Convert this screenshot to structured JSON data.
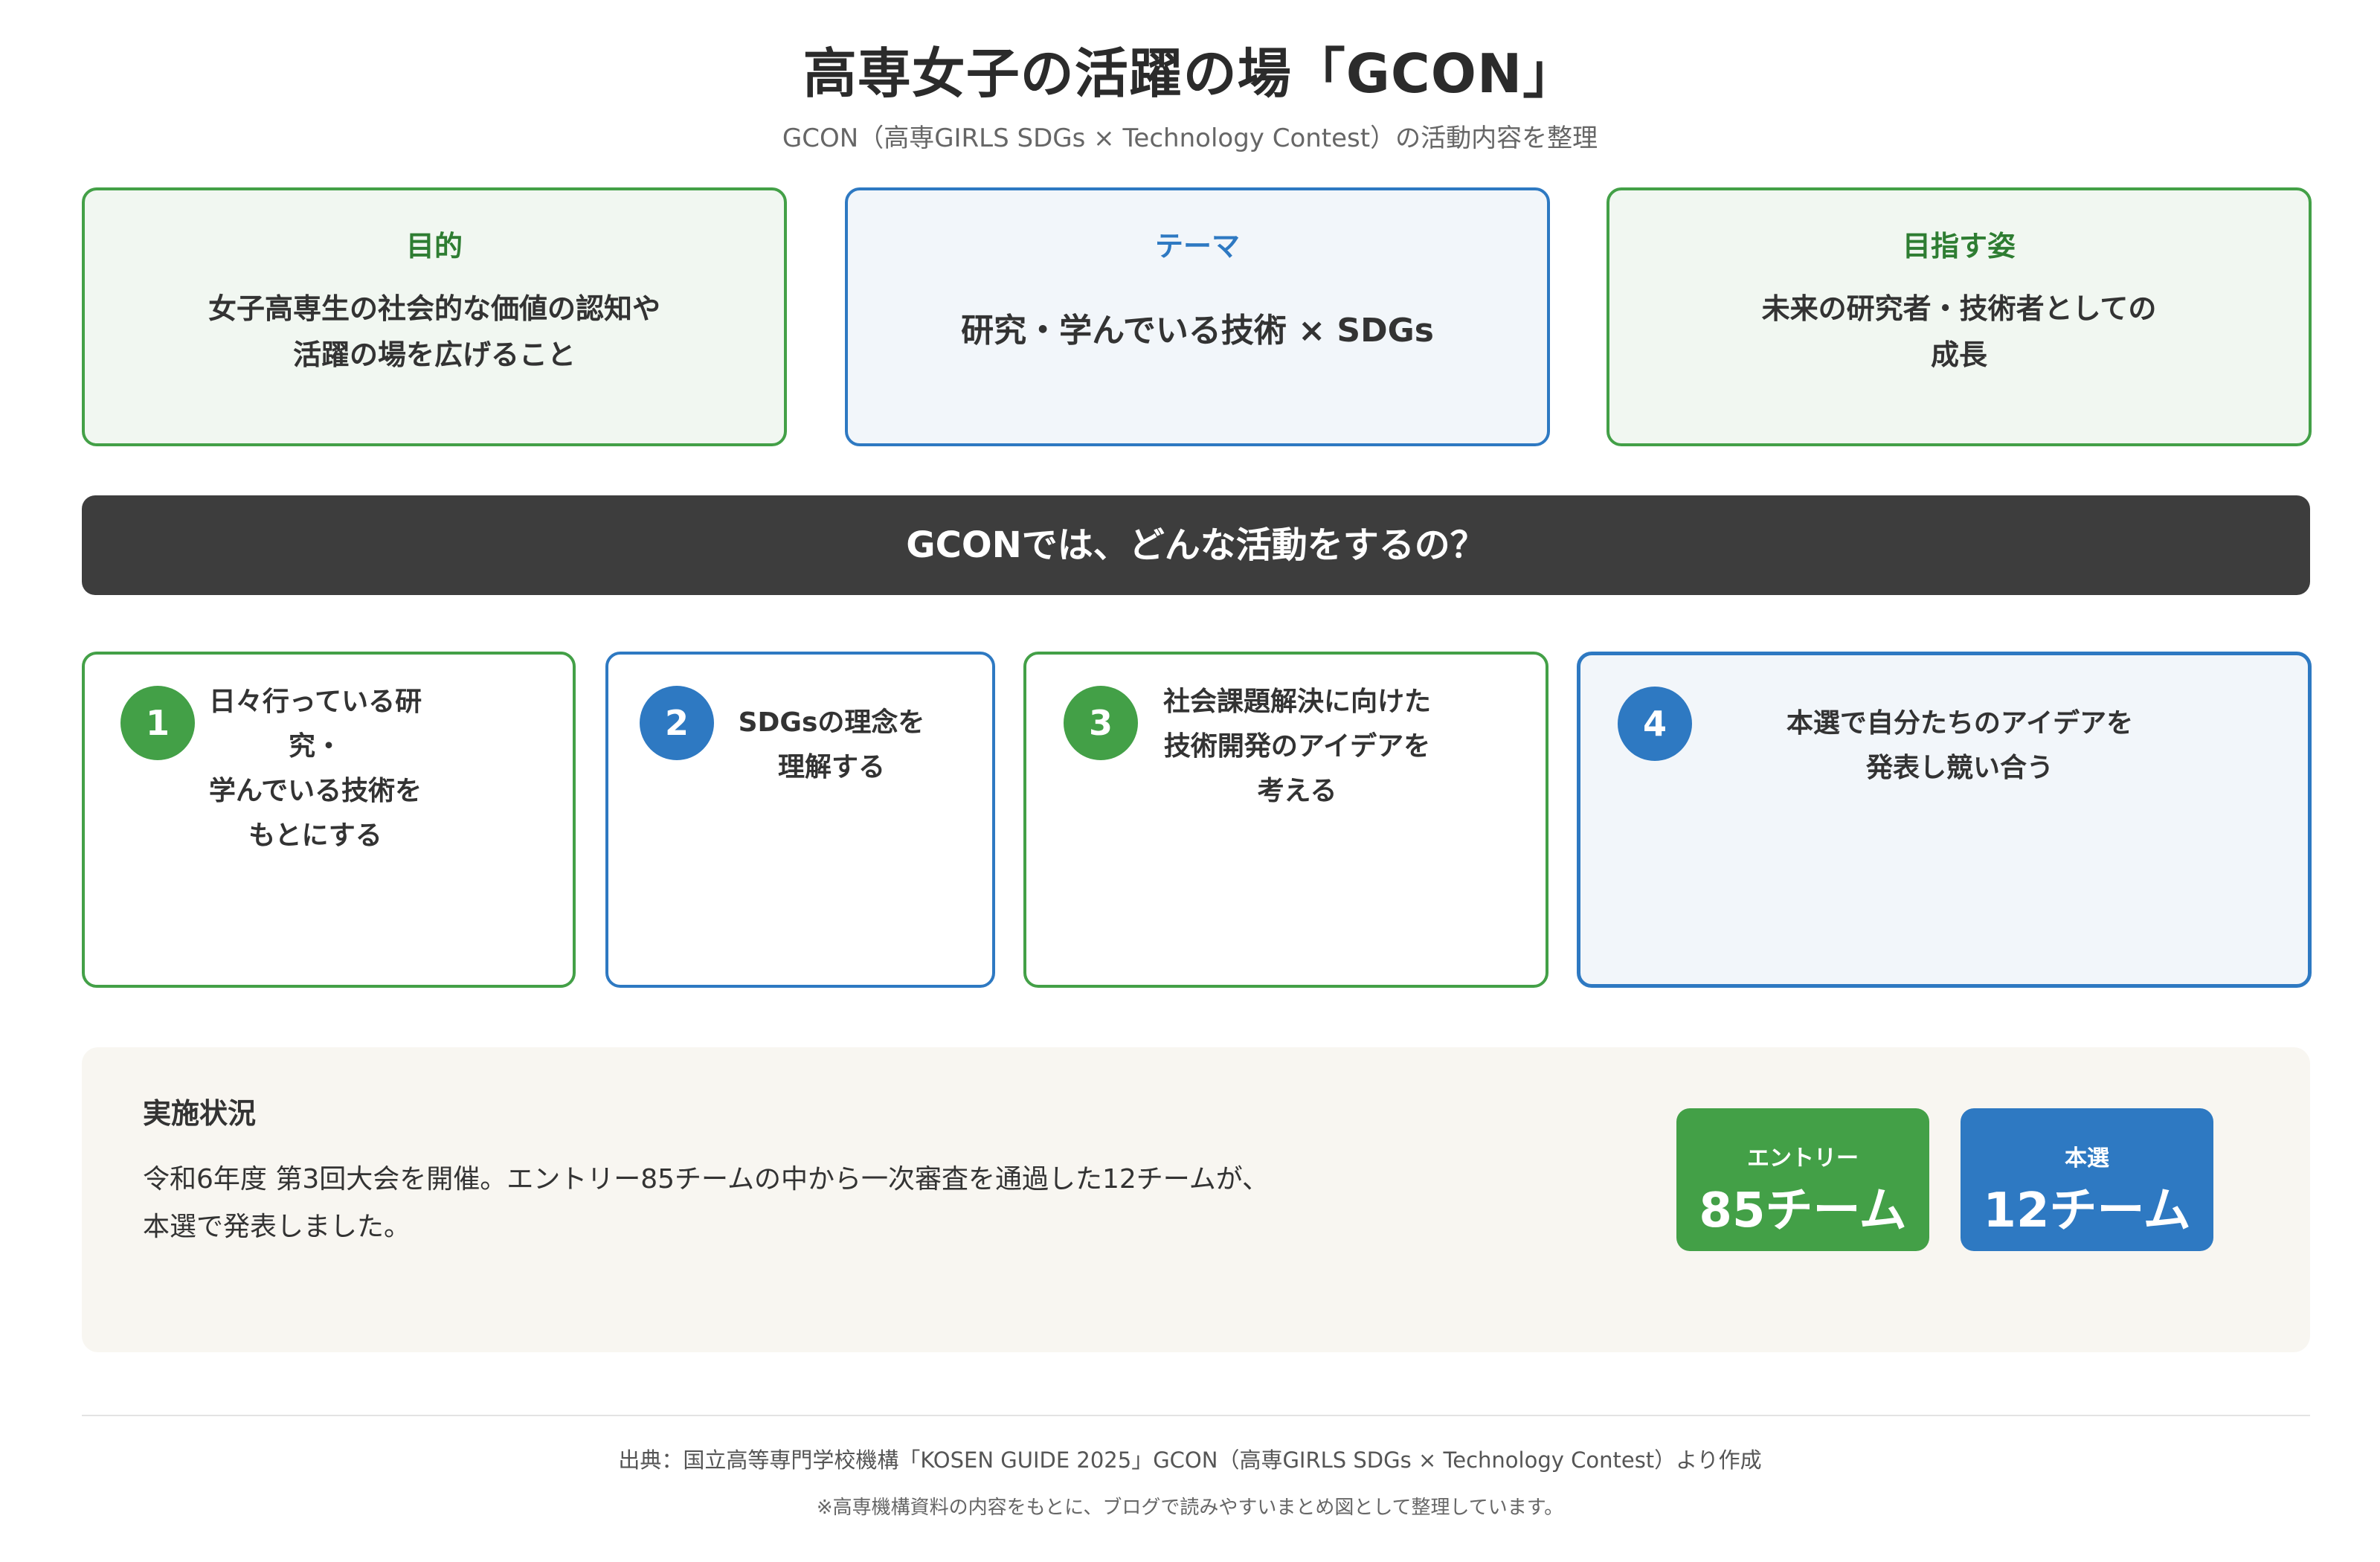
{
  "header": {
    "title": "高専女子の活躍の場「GCON」",
    "subtitle": "GCON（高専GIRLS SDGs × Technology Contest）の活動内容を整理"
  },
  "overview": {
    "purpose": {
      "heading": "目的",
      "line1": "女子高専生の社会的な価値の認知や",
      "line2": "活躍の場を広げること"
    },
    "theme": {
      "heading": "テーマ",
      "text": "研究・学んでいる技術 × SDGs"
    },
    "goal": {
      "heading": "目指す姿",
      "line1": "未来の研究者・技術者としての",
      "line2": "成長"
    }
  },
  "banner": {
    "text": "GCONでは、どんな活動をするの？"
  },
  "steps": [
    {
      "number": "1",
      "lines": [
        "日々行っている研究・",
        "学んでいる技術を",
        "もとにする"
      ]
    },
    {
      "number": "2",
      "lines": [
        "SDGsの理念を",
        "理解する"
      ]
    },
    {
      "number": "3",
      "lines": [
        "社会課題解決に向けた",
        "技術開発のアイデアを",
        "考える"
      ]
    },
    {
      "number": "4",
      "lines": [
        "本選で自分たちのアイデアを",
        "発表し競い合う"
      ]
    }
  ],
  "status": {
    "heading": "実施状況",
    "line1": "令和6年度 第3回大会を開催。エントリー85チームの中から一次審査を通過した12チームが、",
    "line2": "本選で発表しました。",
    "entry": {
      "label": "エントリー",
      "value": "85チーム"
    },
    "final": {
      "label": "本選",
      "value": "12チーム"
    }
  },
  "footer": {
    "source": "出典：国立高等専門学校機構「KOSEN GUIDE 2025」GCON（高専GIRLS SDGs × Technology Contest）より作成",
    "note": "※高専機構資料の内容をもとに、ブログで読みやすいまとめ図として整理しています。"
  },
  "colors": {
    "green": "#43a047",
    "blue": "#2e79c2",
    "dark": "#3d3d3d",
    "beige": "#f8f6f1"
  }
}
